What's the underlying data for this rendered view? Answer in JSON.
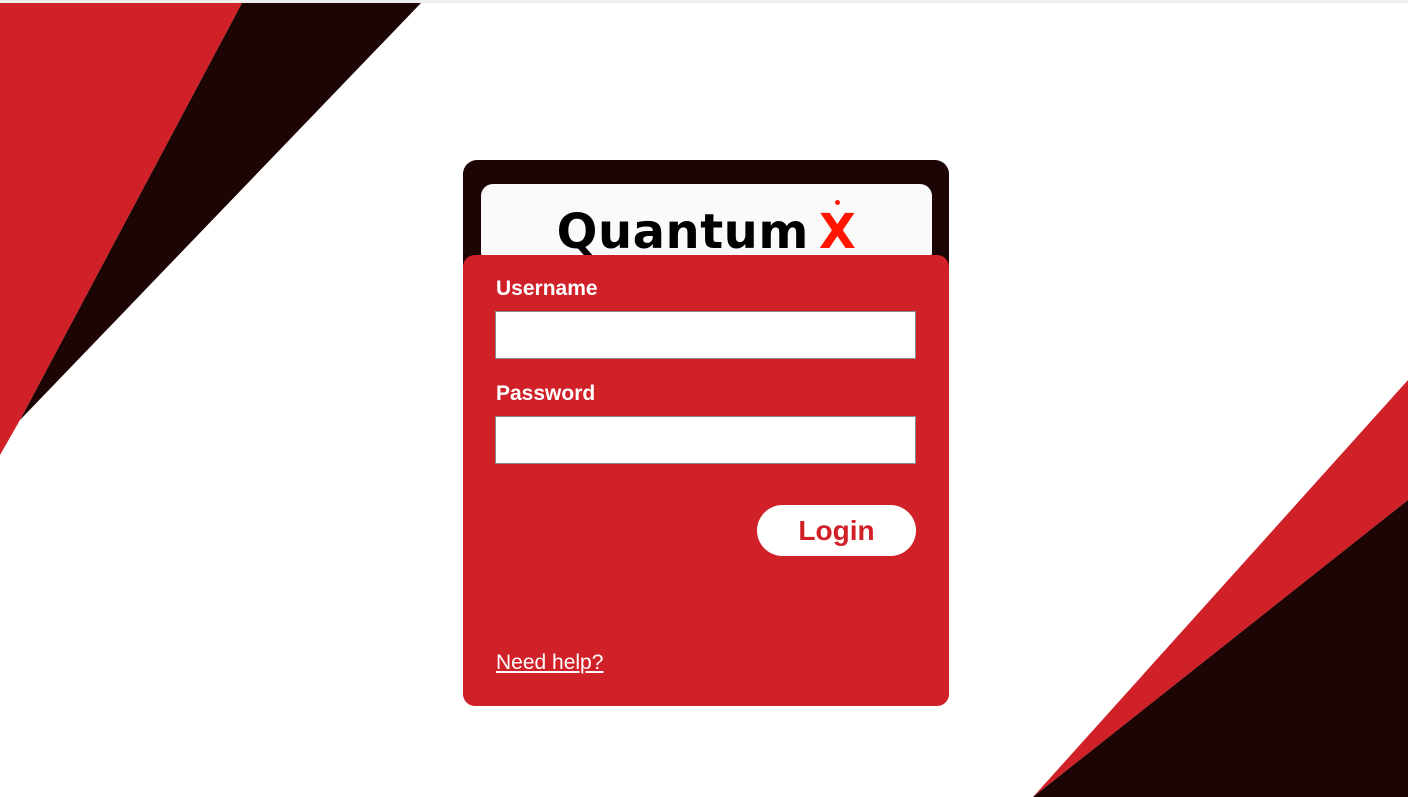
{
  "brand": {
    "name": "Quantum",
    "mark": "X"
  },
  "form": {
    "username_label": "Username",
    "username_value": "",
    "password_label": "Password",
    "password_value": "",
    "login_label": "Login",
    "help_link": "Need help?"
  },
  "colors": {
    "accent_red": "#d02028",
    "dark": "#1c0504",
    "logo_x": "#ff1500",
    "background": "#ffffff"
  }
}
